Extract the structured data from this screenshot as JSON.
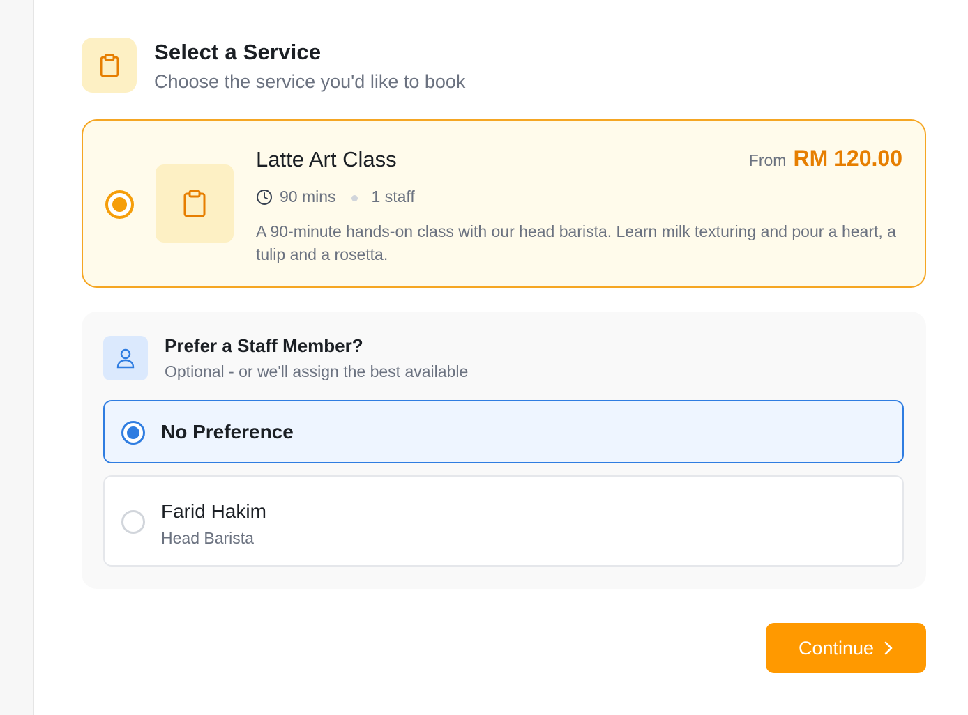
{
  "header": {
    "title": "Select a Service",
    "subtitle": "Choose the service you'd like to book",
    "icon": "clipboard-icon"
  },
  "service": {
    "name": "Latte Art Class",
    "price_prefix": "From",
    "price": "RM 120.00",
    "duration": "90 mins",
    "staff_count": "1 staff",
    "description": "A 90-minute hands-on class with our head barista. Learn milk texturing and pour a heart, a tulip and a rosetta.",
    "selected": true,
    "icon": "clipboard-icon",
    "duration_icon": "clock-icon"
  },
  "staff": {
    "title": "Prefer a Staff Member?",
    "subtitle": "Optional - or we'll assign the best available",
    "icon": "user-icon",
    "options": [
      {
        "label": "No Preference",
        "selected": true
      },
      {
        "label": "Farid Hakim",
        "role": "Head Barista",
        "selected": false
      }
    ]
  },
  "actions": {
    "continue_label": "Continue",
    "continue_icon": "chevron-right-icon"
  },
  "colors": {
    "accent_orange": "#ff9900",
    "accent_blue": "#2f7de1",
    "card_bg": "#fffbeb"
  }
}
